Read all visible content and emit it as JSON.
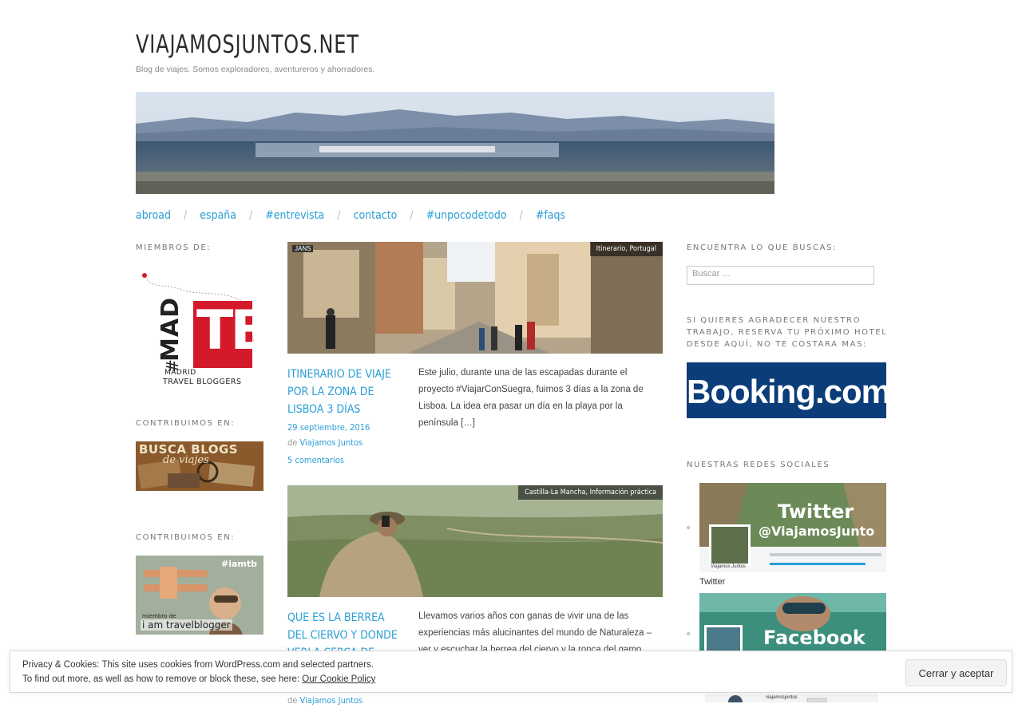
{
  "site": {
    "title": "VIAJAMOSJUNTOS.NET",
    "description": "Blog de viajes. Somos exploradores, aventureros y ahorradores."
  },
  "nav": {
    "items": [
      "abroad",
      "españa",
      "#entrevista",
      "contacto",
      "#unpocodetodo",
      "#faqs"
    ],
    "separator": "/"
  },
  "left_sidebar": {
    "widget1_title": "MIEMBROS DE:",
    "madtb_logo": {
      "top": "#",
      "mid": "MAD",
      "big": "TB",
      "line1": "MADRID",
      "line2": "TRAVEL BLOGGERS"
    },
    "widget2_title": "CONTRIBUIMOS EN:",
    "busca_blogs": {
      "line1": "BUSCA BLOGS",
      "line2": "de viajes"
    },
    "widget3_title": "CONTRIBUIMOS EN:",
    "iamtb": {
      "tag": "#iamtb",
      "line1": "miembro de",
      "line2": "i am travelblogger"
    }
  },
  "posts": [
    {
      "categories": "Itinerario,  Portugal",
      "title": "ITINERARIO DE VIAJE POR LA ZONA DE LISBOA 3 DÍAS",
      "date": "29  septiembre,  2016",
      "author_prefix": "de",
      "author": "Viajamos  Juntos",
      "comments": "5  comentarios",
      "excerpt": "Este julio, durante una de las escapadas durante el proyecto #ViajarConSuegra, fuimos 3 días a la zona de Lisboa. La idea era pasar un día en la playa por la península […]",
      "image_text": "JANS"
    },
    {
      "categories": "Castilla-La Mancha,  Información  práctica",
      "title": "QUE ES LA BERREA DEL CIERVO Y DONDE VERLA CERCA DE",
      "author_prefix": "de",
      "author": "Viajamos  Juntos",
      "excerpt": "Llevamos varios años con ganas de vivir una de las experiencias más alucinantes del mundo de Naturaleza – ver y escuchar la berrea del ciervo y la ronca del gamo."
    }
  ],
  "right_sidebar": {
    "search_title": "ENCUENTRA LO QUE BUSCAS:",
    "search_placeholder": "Buscar …",
    "booking_title": "SI QUIERES AGRADECER NUESTRO TRABAJO, RESERVA TU PRÓXIMO HOTEL DESDE AQUÍ, NO TE COSTARA MAS:",
    "booking_logo": "Booking.com",
    "social_title": "NUESTRAS REDES SOCIALES",
    "bullet": "◦",
    "twitter": {
      "banner": "Twitter",
      "handle": "@ViajamosJunto",
      "name": "Viajamos Juntos",
      "label": "Twitter"
    },
    "facebook": {
      "banner": "Facebook"
    },
    "third_card_name": "viajamosjuntos"
  },
  "cookie": {
    "line1": "Privacy & Cookies: This site uses cookies from WordPress.com and selected partners.",
    "line2": "To find out more, as well as how to remove or block these, see here:",
    "link": "Our Cookie Policy",
    "button": "Cerrar y aceptar"
  },
  "colors": {
    "link": "#2a9fd6",
    "madtb_red": "#d41a2a",
    "booking_blue": "#0a3d7a"
  }
}
